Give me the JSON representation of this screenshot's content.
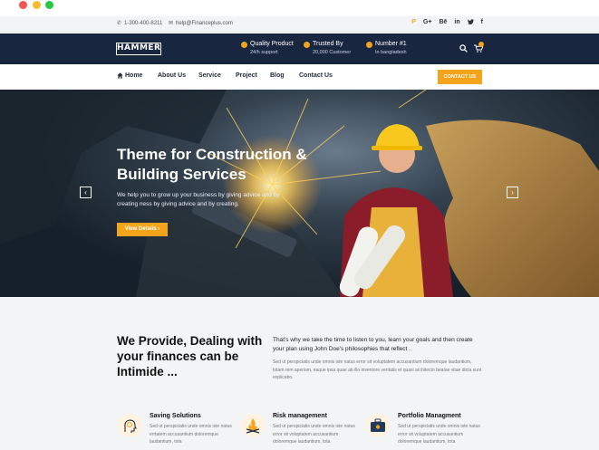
{
  "topbar": {
    "phone": "1-300-400-8211",
    "email": "help@Financeplus.com",
    "socials": [
      "P",
      "G+",
      "Bē",
      "in",
      "🐦",
      "f"
    ]
  },
  "header": {
    "logo": "HAMMER",
    "features": [
      {
        "title": "Quality Product",
        "sub": "24/h support"
      },
      {
        "title": "Trusted By",
        "sub": "20,000 Customer"
      },
      {
        "title": "Number #1",
        "sub": "In bangladesh"
      }
    ]
  },
  "nav": {
    "items": [
      "Home",
      "About Us",
      "Service",
      "Project",
      "Blog",
      "Contact Us"
    ],
    "cta": "CONTACT US"
  },
  "hero": {
    "title_line1": "Theme for Construction &",
    "title_line2": "Building Services",
    "subtitle": "We help you to grow up your business by giving advice and by creating ness by giving advice and by creating.",
    "button": "View Details  ›",
    "prev": "‹",
    "next": "›"
  },
  "about": {
    "heading": "We Provide, Dealing with your finances can be Intimide ...",
    "lead": "That's why we take the time to listen to you, learn your goals and then create your plan using John Doe's philosophies that reflect .",
    "body": "Sed ut perspiciatis unde omnis iste natus error sit voluptatem accusantium doloremque laudantium, totam rem aperiam, eaque ipsa quae ab illo inventore veritatis et quasi architecto beatae vitae dicta sunt explicabo."
  },
  "services": [
    {
      "title": "Saving Solutions",
      "text": "Sed ut perspiciatis unde omnis iste natus errtatem accusantium doloremque laudantium, tota"
    },
    {
      "title": "Risk management",
      "text": "Sed ut perspiciatis unde omnis iste natus error sit voluptatem accusantium doloremque laudantium, tota"
    },
    {
      "title": "Portfolio Managment",
      "text": "Sed ut perspiciatis unde omnis iste natus error sit voluptatem accusantium doloremque laudantium, tota"
    }
  ],
  "colors": {
    "accent": "#f4a41b",
    "navy": "#18263f"
  }
}
